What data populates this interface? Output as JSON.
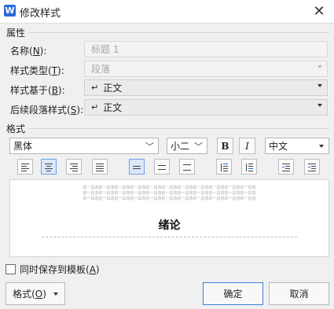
{
  "window": {
    "title": "修改样式",
    "app_icon": "W"
  },
  "properties": {
    "section_label": "属性",
    "name": {
      "label": "名称(",
      "hotkey": "N",
      "label_end": "):",
      "value": "标题 1"
    },
    "style_type": {
      "label": "样式类型(",
      "hotkey": "T",
      "label_end": "):",
      "value": "段落"
    },
    "based_on": {
      "label": "样式基于(",
      "hotkey": "B",
      "label_end": "):",
      "value": "正文"
    },
    "following": {
      "label": "后续段落样式(",
      "hotkey": "S",
      "label_end": "):",
      "value": "正文"
    }
  },
  "format": {
    "section_label": "格式",
    "font": "黑体",
    "size": "小二",
    "bold": "B",
    "italic": "I",
    "script": "中文"
  },
  "preview": {
    "sample_line": "前一段落前一段落前一段落前一段落前一段落前一段落前一段落前一段落前一段落前一段落前一段落",
    "heading": "绪论"
  },
  "footer": {
    "save_to_template": {
      "label": "同时保存到模板(",
      "hotkey": "A",
      "label_end": ")"
    },
    "format_button": {
      "label": "格式(",
      "hotkey": "O",
      "label_end": ")"
    },
    "ok": "确定",
    "cancel": "取消"
  }
}
